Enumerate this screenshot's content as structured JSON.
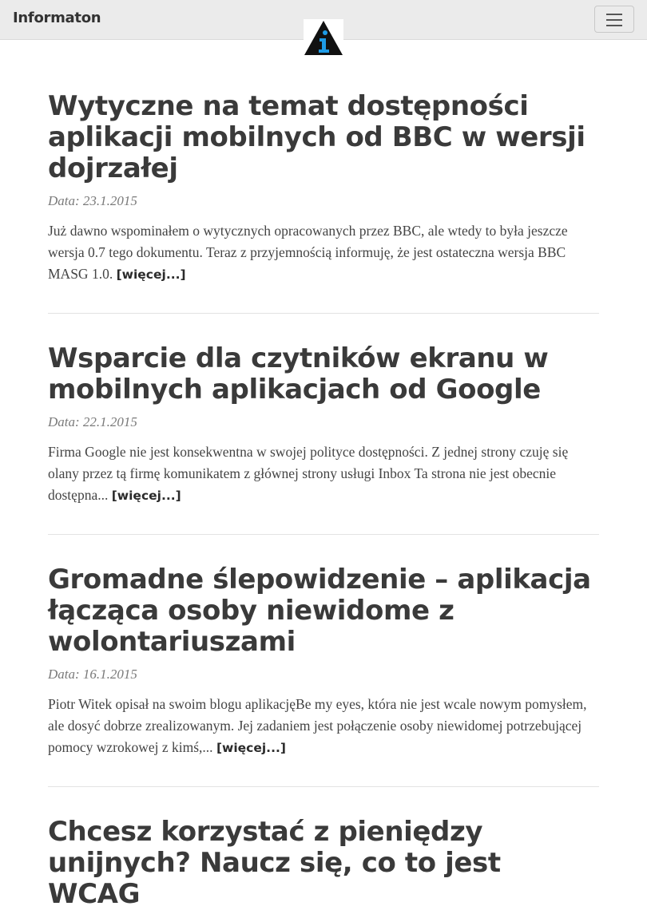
{
  "header": {
    "brand": "Informaton",
    "logo_icon": "info-triangle-logo",
    "menu_icon": "hamburger-menu-icon",
    "colors": {
      "navbar_bg": "#ebebeb",
      "logo_blue": "#1e9be6",
      "logo_black": "#111111"
    }
  },
  "posts": [
    {
      "title": "Wytyczne na temat dostępności aplikacji mobilnych od BBC w wersji dojrzałej",
      "date": "Data: 23.1.2015",
      "excerpt": "Już dawno wspominałem o wytycznych opracowanych przez BBC, ale wtedy to była jeszcze wersja 0.7 tego dokumentu. Teraz z przyjemnością informuję, że jest ostateczna wersja BBC MASG 1.0. ",
      "more": "[więcej...]"
    },
    {
      "title": "Wsparcie dla czytników ekranu w mobilnych aplikacjach od Google",
      "date": "Data: 22.1.2015",
      "excerpt": "Firma Google nie jest konsekwentna w swojej polityce dostępności. Z jednej strony czuję się olany przez tą firmę komunikatem z głównej strony usługi Inbox Ta strona nie jest obecnie dostępna... ",
      "more": "[więcej...]"
    },
    {
      "title": "Gromadne ślepowidzenie – aplikacja łącząca osoby niewidome z wolontariuszami",
      "date": "Data: 16.1.2015",
      "excerpt": "Piotr Witek opisał na swoim blogu aplikacjęBe my eyes, która nie jest wcale nowym pomysłem, ale dosyć dobrze zrealizowanym. Jej zadaniem jest połączenie osoby niewidomej potrzebującej pomocy wzrokowej z kimś,... ",
      "more": "[więcej...]"
    },
    {
      "title": "Chcesz korzystać z pieniędzy unijnych? Naucz się, co to jest WCAG"
    }
  ]
}
